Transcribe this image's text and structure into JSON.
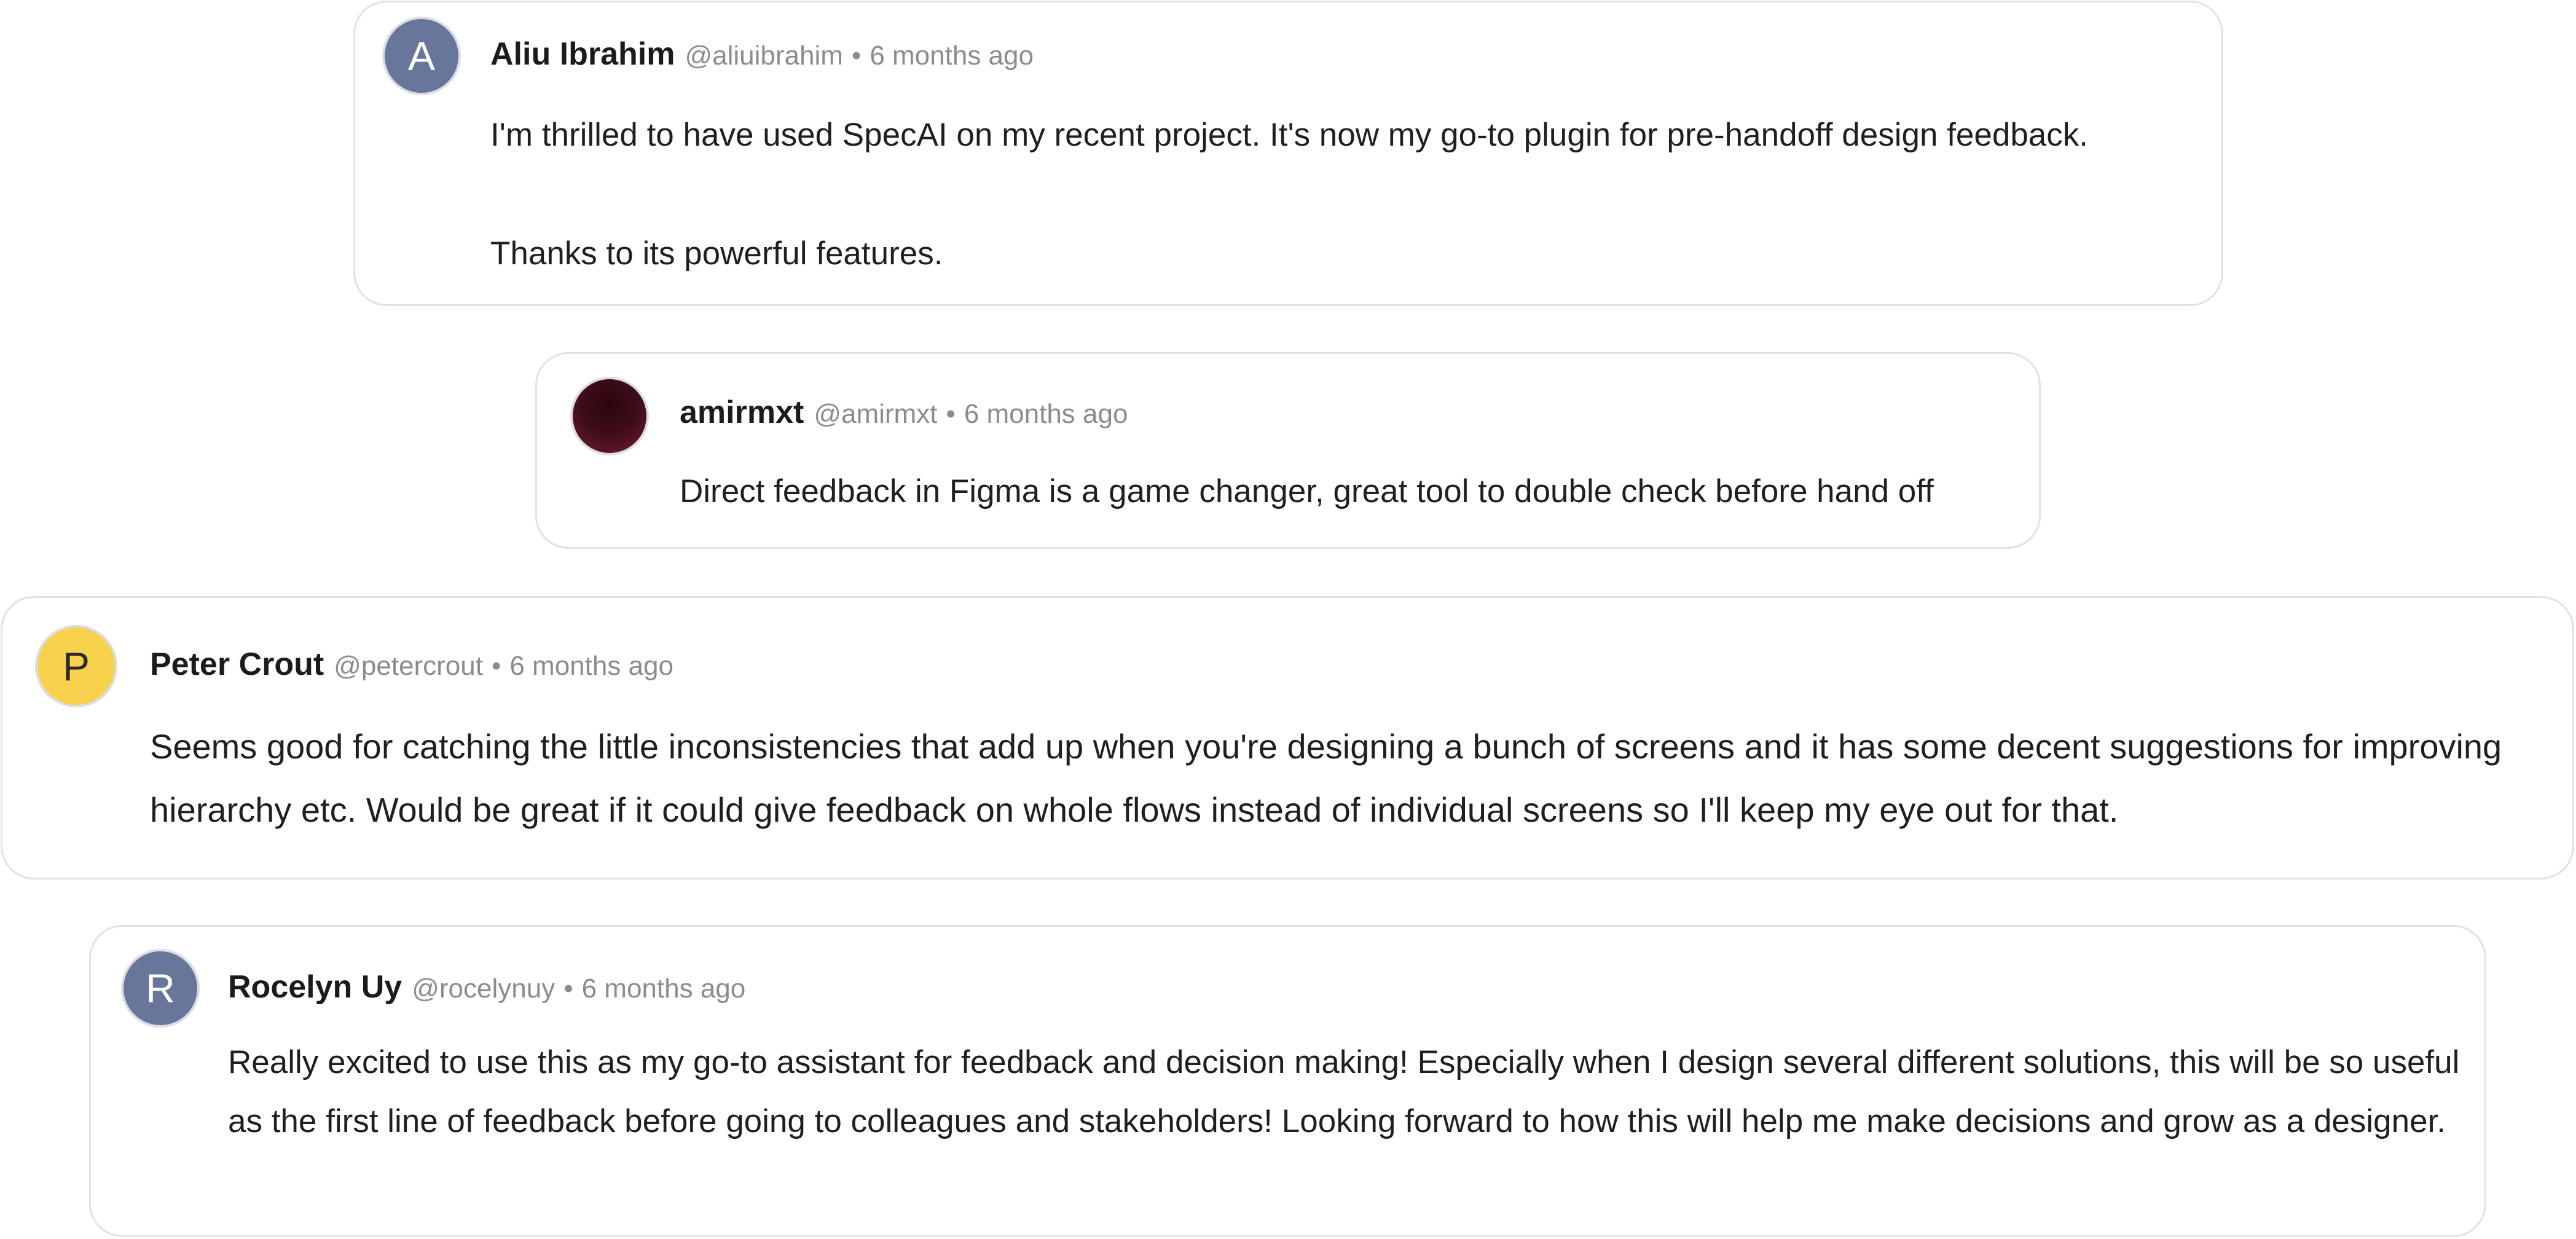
{
  "comments": [
    {
      "avatar_initial": "A",
      "avatar_color": "#67769a",
      "name": "Aliu Ibrahim",
      "handle": "@aliuibrahim",
      "separator": "•",
      "time": "6 months ago",
      "paragraphs": [
        "I'm thrilled to have used SpecAI on my recent project. It's now my go-to plugin for pre-handoff design feedback.",
        "Thanks to its powerful features."
      ]
    },
    {
      "avatar_initial": "",
      "avatar_color": "#4a0f1c",
      "name": "amirmxt",
      "handle": "@amirmxt",
      "separator": "•",
      "time": "6 months ago",
      "paragraphs": [
        "Direct feedback in Figma is a game changer, great tool to double check before hand off"
      ]
    },
    {
      "avatar_initial": "P",
      "avatar_color": "#f8d24d",
      "name": "Peter Crout",
      "handle": "@petercrout",
      "separator": "•",
      "time": "6 months ago",
      "paragraphs": [
        "Seems good for catching the little inconsistencies that add up when you're designing a bunch of screens and it has some decent suggestions for improving hierarchy etc. Would be great if it could give feedback on whole flows instead of individual screens so I'll keep my eye out for that."
      ]
    },
    {
      "avatar_initial": "R",
      "avatar_color": "#67769a",
      "name": "Rocelyn Uy",
      "handle": "@rocelynuy",
      "separator": "•",
      "time": "6 months ago",
      "paragraphs": [
        "Really excited to use this as my go-to assistant for feedback and decision making! Especially when I design several different solutions, this will be so useful as the first line of feedback before going to colleagues and stakeholders! Looking forward to how this will help me make decisions and grow as a designer."
      ]
    }
  ]
}
